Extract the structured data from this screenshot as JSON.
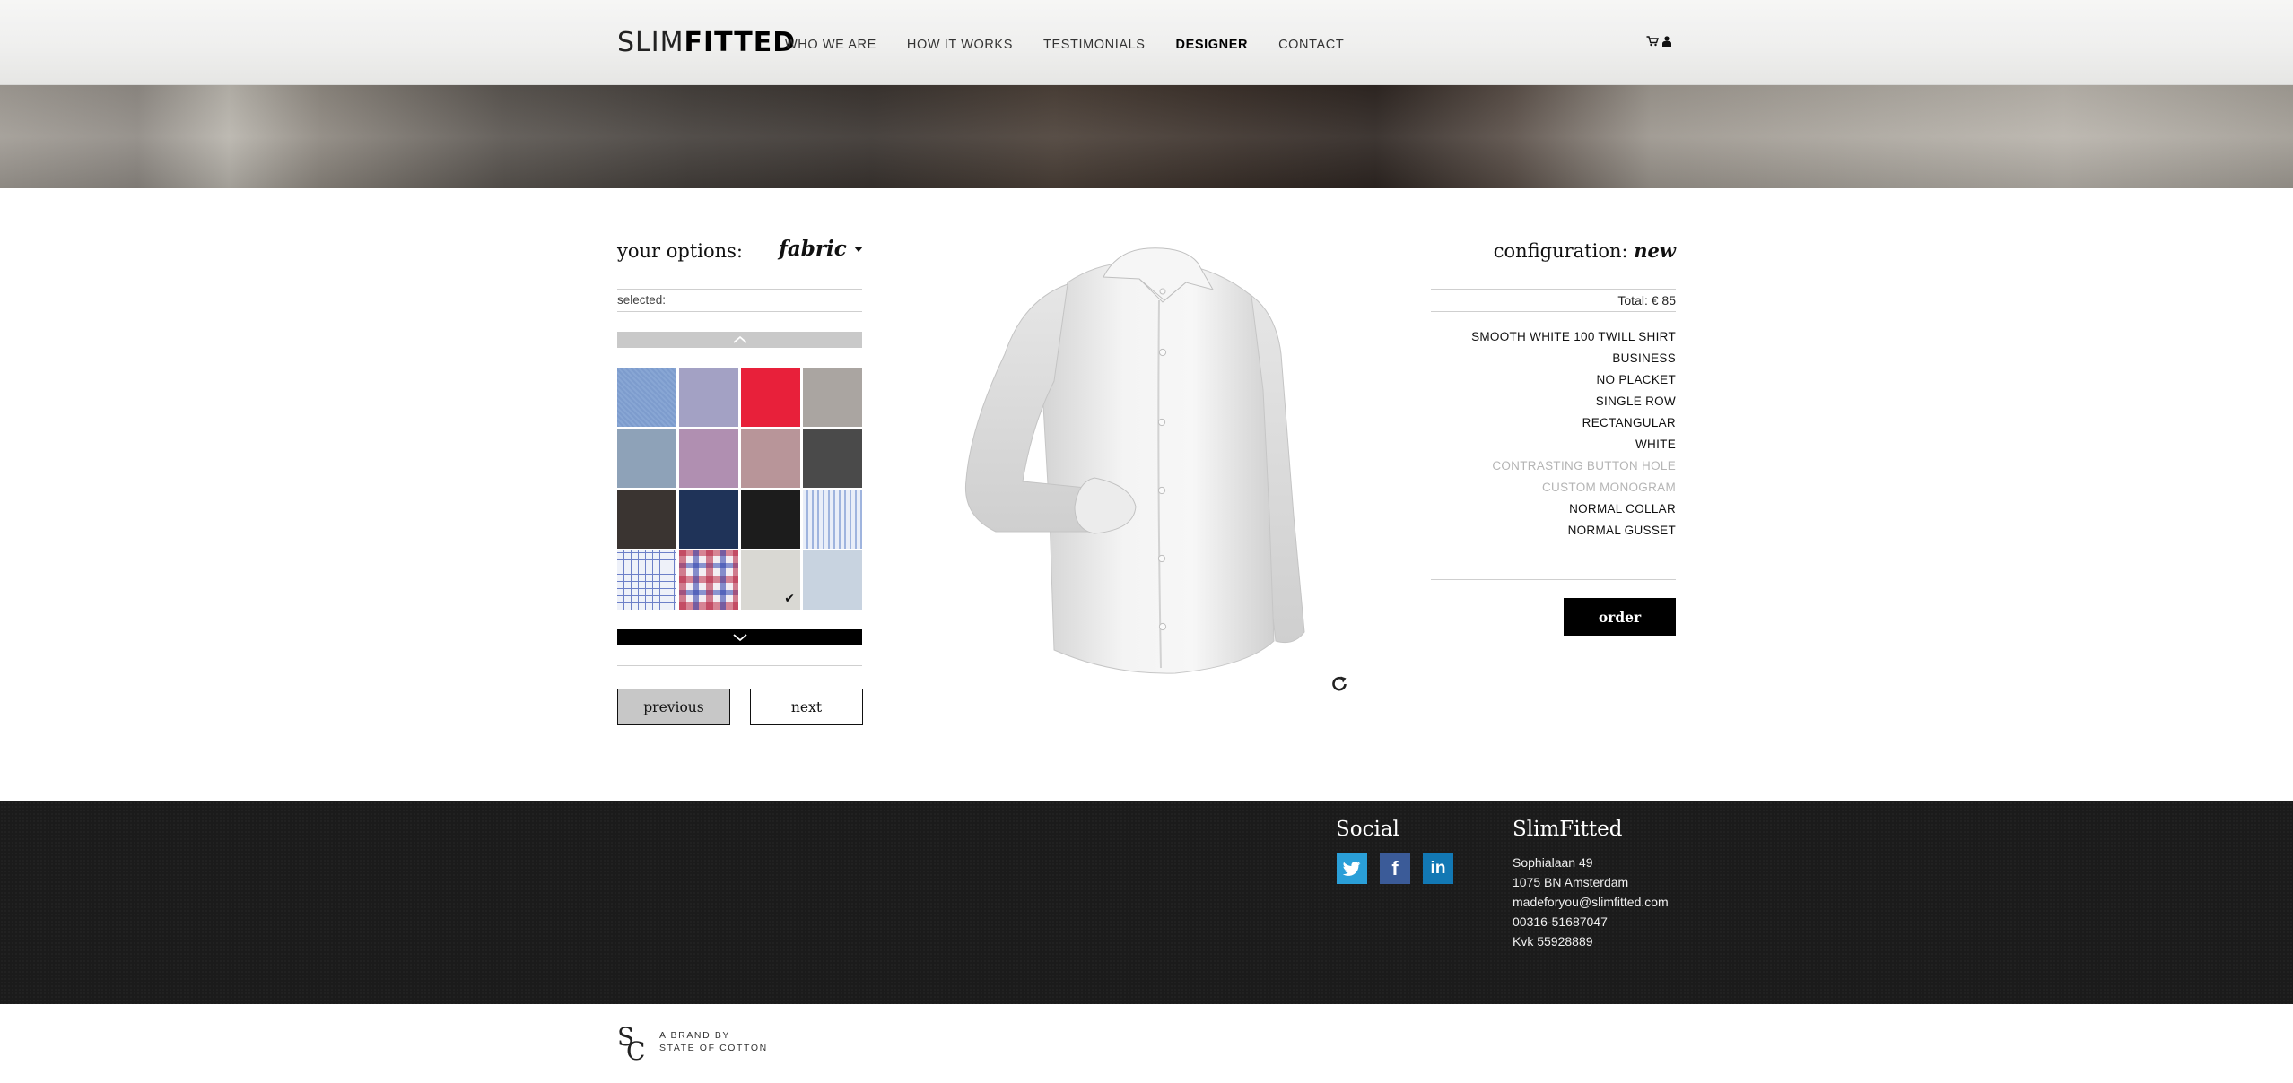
{
  "header": {
    "logo_light": "SLIM",
    "logo_bold": "FITTED",
    "nav": [
      {
        "label": "WHO WE ARE",
        "active": false
      },
      {
        "label": "HOW IT WORKS",
        "active": false
      },
      {
        "label": "TESTIMONIALS",
        "active": false
      },
      {
        "label": "DESIGNER",
        "active": true
      },
      {
        "label": "CONTACT",
        "active": false
      }
    ],
    "icons": [
      "cart-icon",
      "user-icon"
    ]
  },
  "options": {
    "label": "your options:",
    "dropdown_value": "fabric",
    "selected_label": "selected:",
    "swatches": [
      {
        "name": "light-blue-oxford",
        "color": "#7d9ccd"
      },
      {
        "name": "lilac-melange",
        "color": "#a3a1c4"
      },
      {
        "name": "red",
        "color": "#e8203a"
      },
      {
        "name": "taupe-grey",
        "color": "#aaa5a1"
      },
      {
        "name": "steel-blue",
        "color": "#8ea2b8"
      },
      {
        "name": "mauve-pink",
        "color": "#b08fb1"
      },
      {
        "name": "dusty-rose",
        "color": "#b89599"
      },
      {
        "name": "charcoal",
        "color": "#4a4a4a"
      },
      {
        "name": "dark-brown",
        "color": "#3a3431"
      },
      {
        "name": "navy",
        "color": "#1f3358"
      },
      {
        "name": "black",
        "color": "#1c1c1c"
      },
      {
        "name": "blue-stripe",
        "color": "#c5d1e8"
      },
      {
        "name": "blue-check",
        "color": "#e8ecf7"
      },
      {
        "name": "red-blue-gingham",
        "color": "#c9b1c6"
      },
      {
        "name": "smooth-white",
        "color": "#d9d8d3",
        "selected": true
      },
      {
        "name": "pale-blue",
        "color": "#c8d3e0"
      }
    ],
    "previous_label": "previous",
    "next_label": "next"
  },
  "configuration": {
    "label": "configuration:",
    "name": "new",
    "total": "Total: € 85",
    "items": [
      {
        "label": "SMOOTH WHITE 100 TWILL SHIRT",
        "active": true
      },
      {
        "label": "BUSINESS",
        "active": true
      },
      {
        "label": "NO PLACKET",
        "active": true
      },
      {
        "label": "SINGLE ROW",
        "active": true
      },
      {
        "label": "RECTANGULAR",
        "active": true
      },
      {
        "label": "WHITE",
        "active": true
      },
      {
        "label": "CONTRASTING BUTTON HOLE",
        "active": false
      },
      {
        "label": "CUSTOM MONOGRAM",
        "active": false
      },
      {
        "label": "NORMAL COLLAR",
        "active": true
      },
      {
        "label": "NORMAL GUSSET",
        "active": true
      }
    ],
    "order_label": "order"
  },
  "footer": {
    "social_heading": "Social",
    "social": [
      {
        "name": "twitter",
        "glyph": "t"
      },
      {
        "name": "facebook",
        "glyph": "f"
      },
      {
        "name": "linkedin",
        "glyph": "in"
      }
    ],
    "company_heading": "SlimFitted",
    "address": [
      "Sophialaan 49",
      "1075 BN Amsterdam",
      "madeforyou@slimfitted.com",
      "00316-51687047",
      "Kvk 55928889"
    ]
  },
  "brand": {
    "line1": "A BRAND BY",
    "line2": "STATE OF COTTON",
    "monogram": "SC"
  }
}
